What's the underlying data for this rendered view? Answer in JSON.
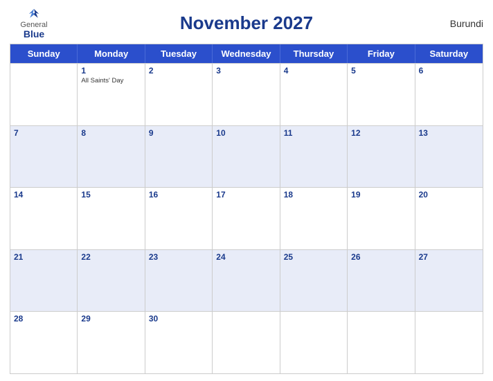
{
  "header": {
    "logo": {
      "general": "General",
      "blue": "Blue"
    },
    "title": "November 2027",
    "country": "Burundi"
  },
  "day_headers": [
    "Sunday",
    "Monday",
    "Tuesday",
    "Wednesday",
    "Thursday",
    "Friday",
    "Saturday"
  ],
  "weeks": [
    [
      {
        "day": "",
        "events": []
      },
      {
        "day": "1",
        "events": [
          "All Saints' Day"
        ]
      },
      {
        "day": "2",
        "events": []
      },
      {
        "day": "3",
        "events": []
      },
      {
        "day": "4",
        "events": []
      },
      {
        "day": "5",
        "events": []
      },
      {
        "day": "6",
        "events": []
      }
    ],
    [
      {
        "day": "7",
        "events": []
      },
      {
        "day": "8",
        "events": []
      },
      {
        "day": "9",
        "events": []
      },
      {
        "day": "10",
        "events": []
      },
      {
        "day": "11",
        "events": []
      },
      {
        "day": "12",
        "events": []
      },
      {
        "day": "13",
        "events": []
      }
    ],
    [
      {
        "day": "14",
        "events": []
      },
      {
        "day": "15",
        "events": []
      },
      {
        "day": "16",
        "events": []
      },
      {
        "day": "17",
        "events": []
      },
      {
        "day": "18",
        "events": []
      },
      {
        "day": "19",
        "events": []
      },
      {
        "day": "20",
        "events": []
      }
    ],
    [
      {
        "day": "21",
        "events": []
      },
      {
        "day": "22",
        "events": []
      },
      {
        "day": "23",
        "events": []
      },
      {
        "day": "24",
        "events": []
      },
      {
        "day": "25",
        "events": []
      },
      {
        "day": "26",
        "events": []
      },
      {
        "day": "27",
        "events": []
      }
    ],
    [
      {
        "day": "28",
        "events": []
      },
      {
        "day": "29",
        "events": []
      },
      {
        "day": "30",
        "events": []
      },
      {
        "day": "",
        "events": []
      },
      {
        "day": "",
        "events": []
      },
      {
        "day": "",
        "events": []
      },
      {
        "day": "",
        "events": []
      }
    ]
  ]
}
